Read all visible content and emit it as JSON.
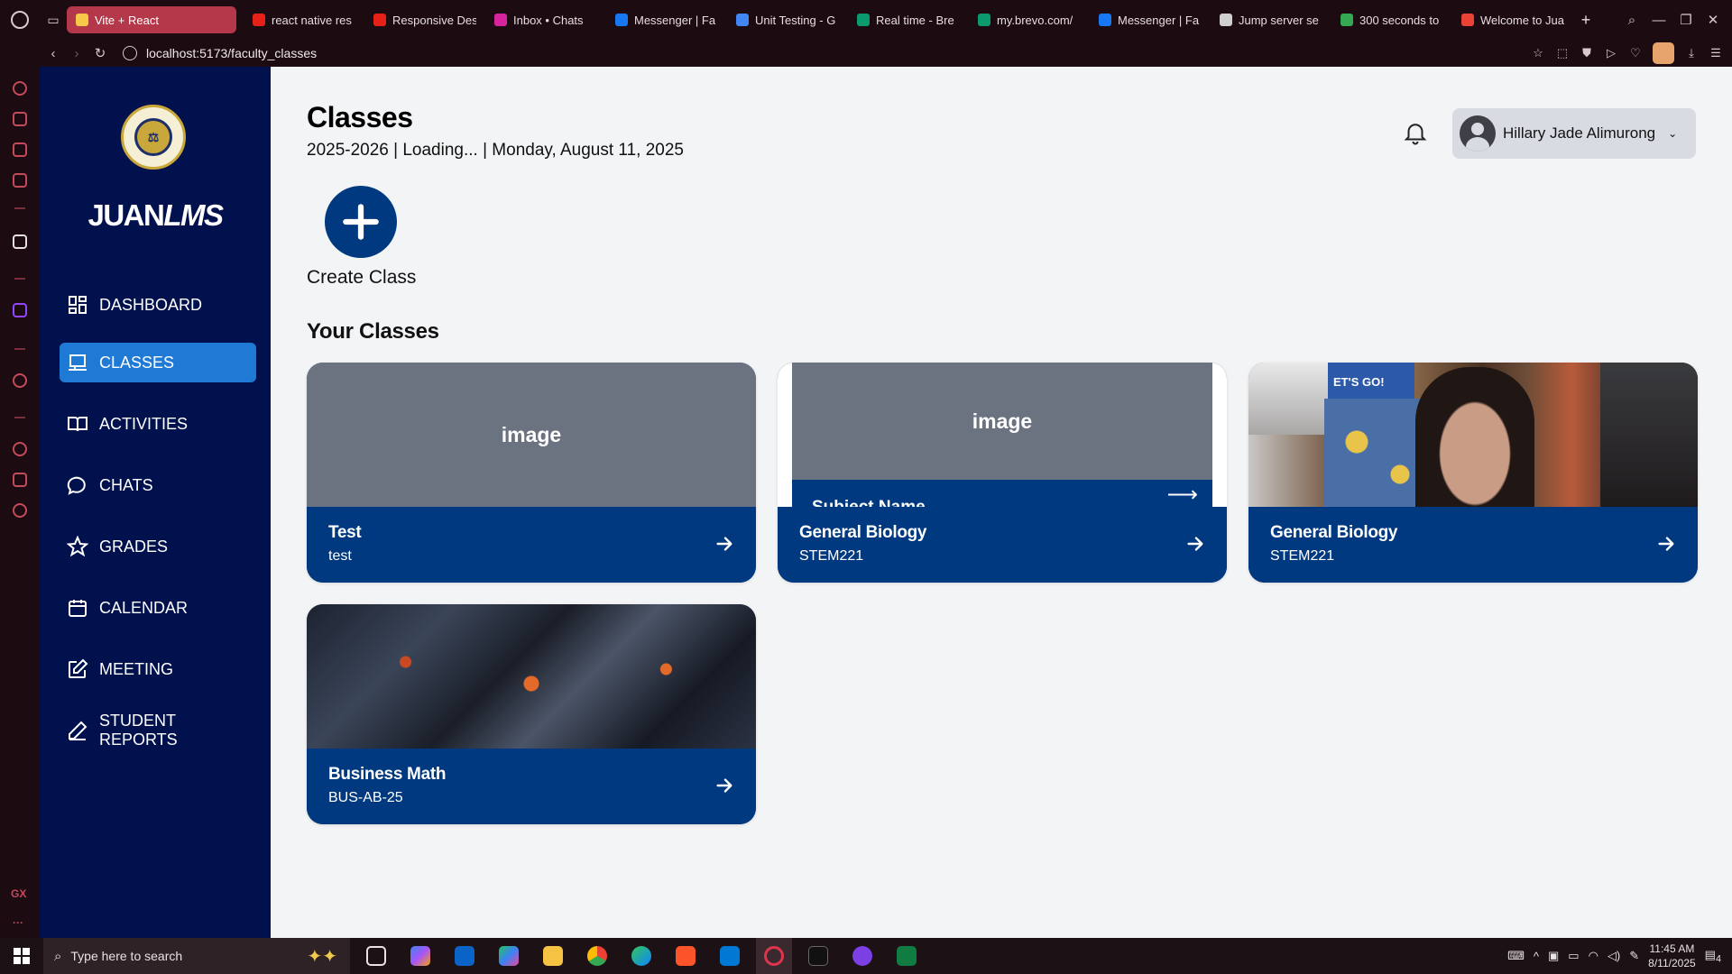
{
  "browser": {
    "tabs": [
      {
        "title": "Vite + React",
        "active": true,
        "fav_color": "#f7c948"
      },
      {
        "title": "react native res",
        "fav_color": "#e62117"
      },
      {
        "title": "Responsive Des",
        "fav_color": "#e62117"
      },
      {
        "title": "Inbox • Chats",
        "fav_color": "#d6249f"
      },
      {
        "title": "Messenger | Fa",
        "fav_color": "#1877f2"
      },
      {
        "title": "Unit Testing - G",
        "fav_color": "#4285f4"
      },
      {
        "title": "Real time - Bre",
        "fav_color": "#0b996e"
      },
      {
        "title": "my.brevo.com/",
        "fav_color": "#0b996e"
      },
      {
        "title": "Messenger | Fa",
        "fav_color": "#1877f2"
      },
      {
        "title": "Jump server se",
        "fav_color": "#cfcfcf"
      },
      {
        "title": "300 seconds to",
        "fav_color": "#34a853"
      },
      {
        "title": "Welcome to Jua",
        "fav_color": "#ea4335"
      }
    ],
    "url": "localhost:5173/faculty_classes"
  },
  "sidebar": {
    "brand_prefix": "JUAN",
    "brand_suffix": "LMS",
    "items": [
      {
        "label": "DASHBOARD",
        "icon": "dashboard-icon"
      },
      {
        "label": "CLASSES",
        "icon": "classes-icon",
        "active": true
      },
      {
        "label": "ACTIVITIES",
        "icon": "book-icon"
      },
      {
        "label": "CHATS",
        "icon": "chat-icon"
      },
      {
        "label": "GRADES",
        "icon": "star-icon"
      },
      {
        "label": "CALENDAR",
        "icon": "calendar-icon"
      },
      {
        "label": "MEETING",
        "icon": "edit-icon"
      },
      {
        "label": "STUDENT REPORTS",
        "icon": "pen-icon"
      }
    ]
  },
  "header": {
    "title": "Classes",
    "subtitle": "2025-2026 | Loading... | Monday, August 11, 2025",
    "user_name": "Hillary Jade Alimurong"
  },
  "main": {
    "create_label": "Create Class",
    "section_title": "Your Classes",
    "image_placeholder": "image",
    "ghost_label": "Subject Name",
    "classes": [
      {
        "name": "Test",
        "code": "test",
        "image": "placeholder"
      },
      {
        "name": "General Biology",
        "code": "STEM221",
        "image": "nested-preview"
      },
      {
        "name": "General Biology",
        "code": "STEM221",
        "image": "photo"
      },
      {
        "name": "Business Math",
        "code": "BUS-AB-25",
        "image": "artwork"
      }
    ]
  },
  "taskbar": {
    "search_placeholder": "Type here to search",
    "time": "11:45 AM",
    "date": "8/11/2025",
    "notification_count": "4"
  },
  "colors": {
    "sidebar_bg": "#00114d",
    "accent": "#1f7ad6",
    "card_bar": "#00397f",
    "main_bg": "#f3f4f6"
  }
}
